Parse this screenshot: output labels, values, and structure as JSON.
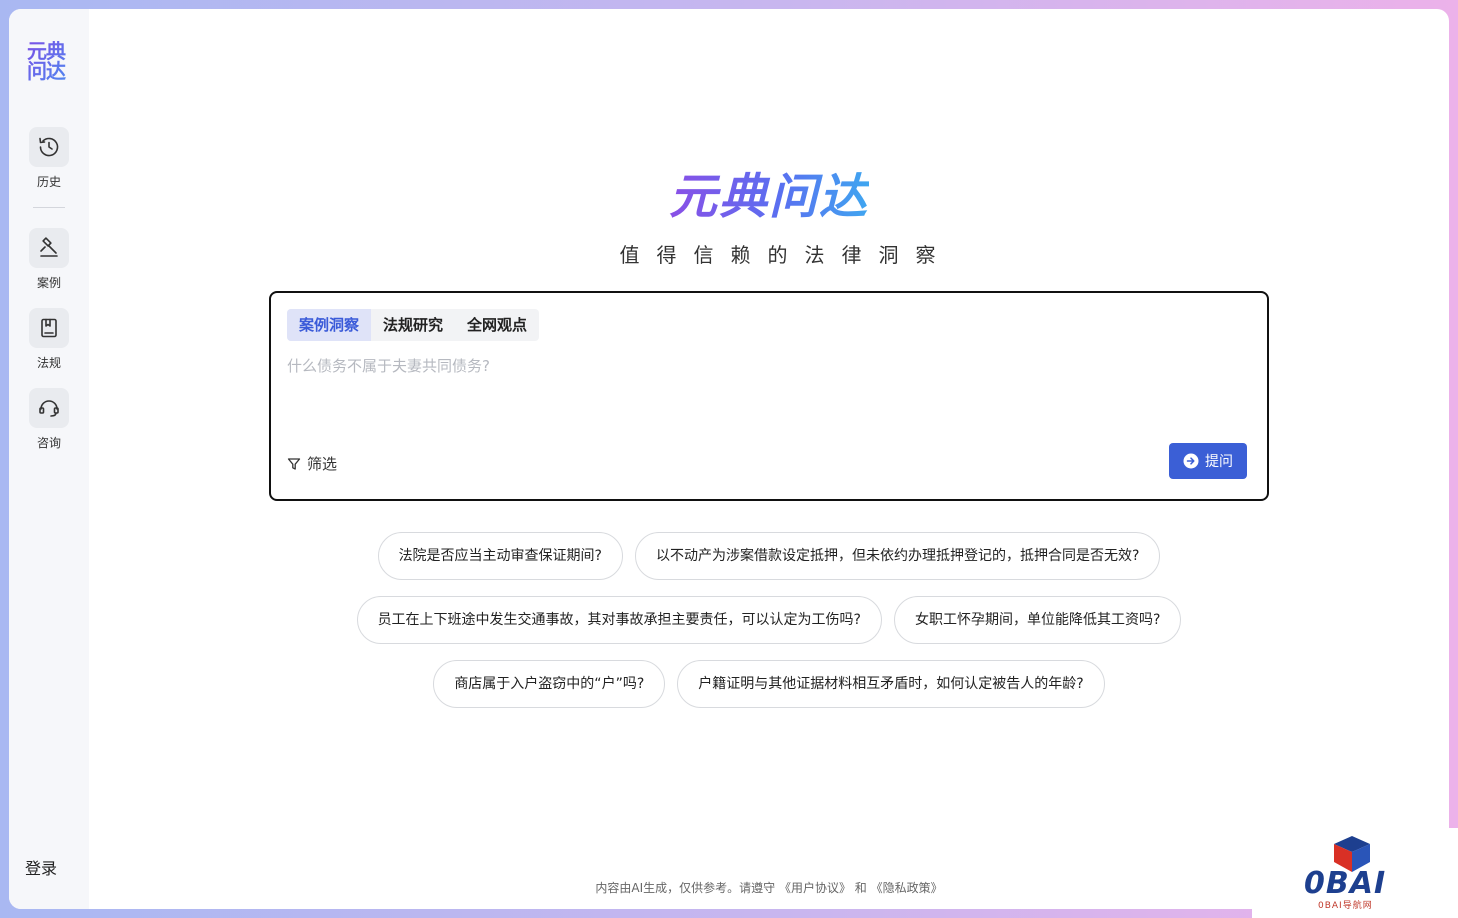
{
  "sidebar": {
    "logo": "元典问达",
    "items": [
      {
        "label": "历史",
        "icon": "history-icon"
      },
      {
        "label": "案例",
        "icon": "gavel-icon"
      },
      {
        "label": "法规",
        "icon": "book-icon"
      },
      {
        "label": "咨询",
        "icon": "headset-icon"
      }
    ],
    "login_label": "登录"
  },
  "hero": {
    "title": "元典问达",
    "tagline": "值得信赖的法律洞察"
  },
  "query": {
    "tabs": [
      {
        "label": "案例洞察",
        "active": true
      },
      {
        "label": "法规研究",
        "active": false
      },
      {
        "label": "全网观点",
        "active": false
      }
    ],
    "placeholder": "什么债务不属于夫妻共同债务?",
    "value": "",
    "filter_label": "筛选",
    "ask_label": "提问"
  },
  "suggestions": [
    [
      "法院是否应当主动审查保证期间?",
      "以不动产为涉案借款设定抵押，但未依约办理抵押登记的，抵押合同是否无效?"
    ],
    [
      "员工在上下班途中发生交通事故，其对事故承担主要责任，可以认定为工伤吗?",
      "女职工怀孕期间，单位能降低其工资吗?"
    ],
    [
      "商店属于入户盗窃中的“户”吗?",
      "户籍证明与其他证据材料相互矛盾时，如何认定被告人的年龄?"
    ]
  ],
  "footer": {
    "text": "内容由AI生成，仅供参考。请遵守",
    "agreement": "《用户协议》",
    "and": "和",
    "privacy": "《隐私政策》"
  },
  "watermark": {
    "brand": "0BAI",
    "sub": "0BAI导航网"
  },
  "colors": {
    "accent": "#3b5fd6",
    "active_tab_bg": "#dfe3f8"
  }
}
